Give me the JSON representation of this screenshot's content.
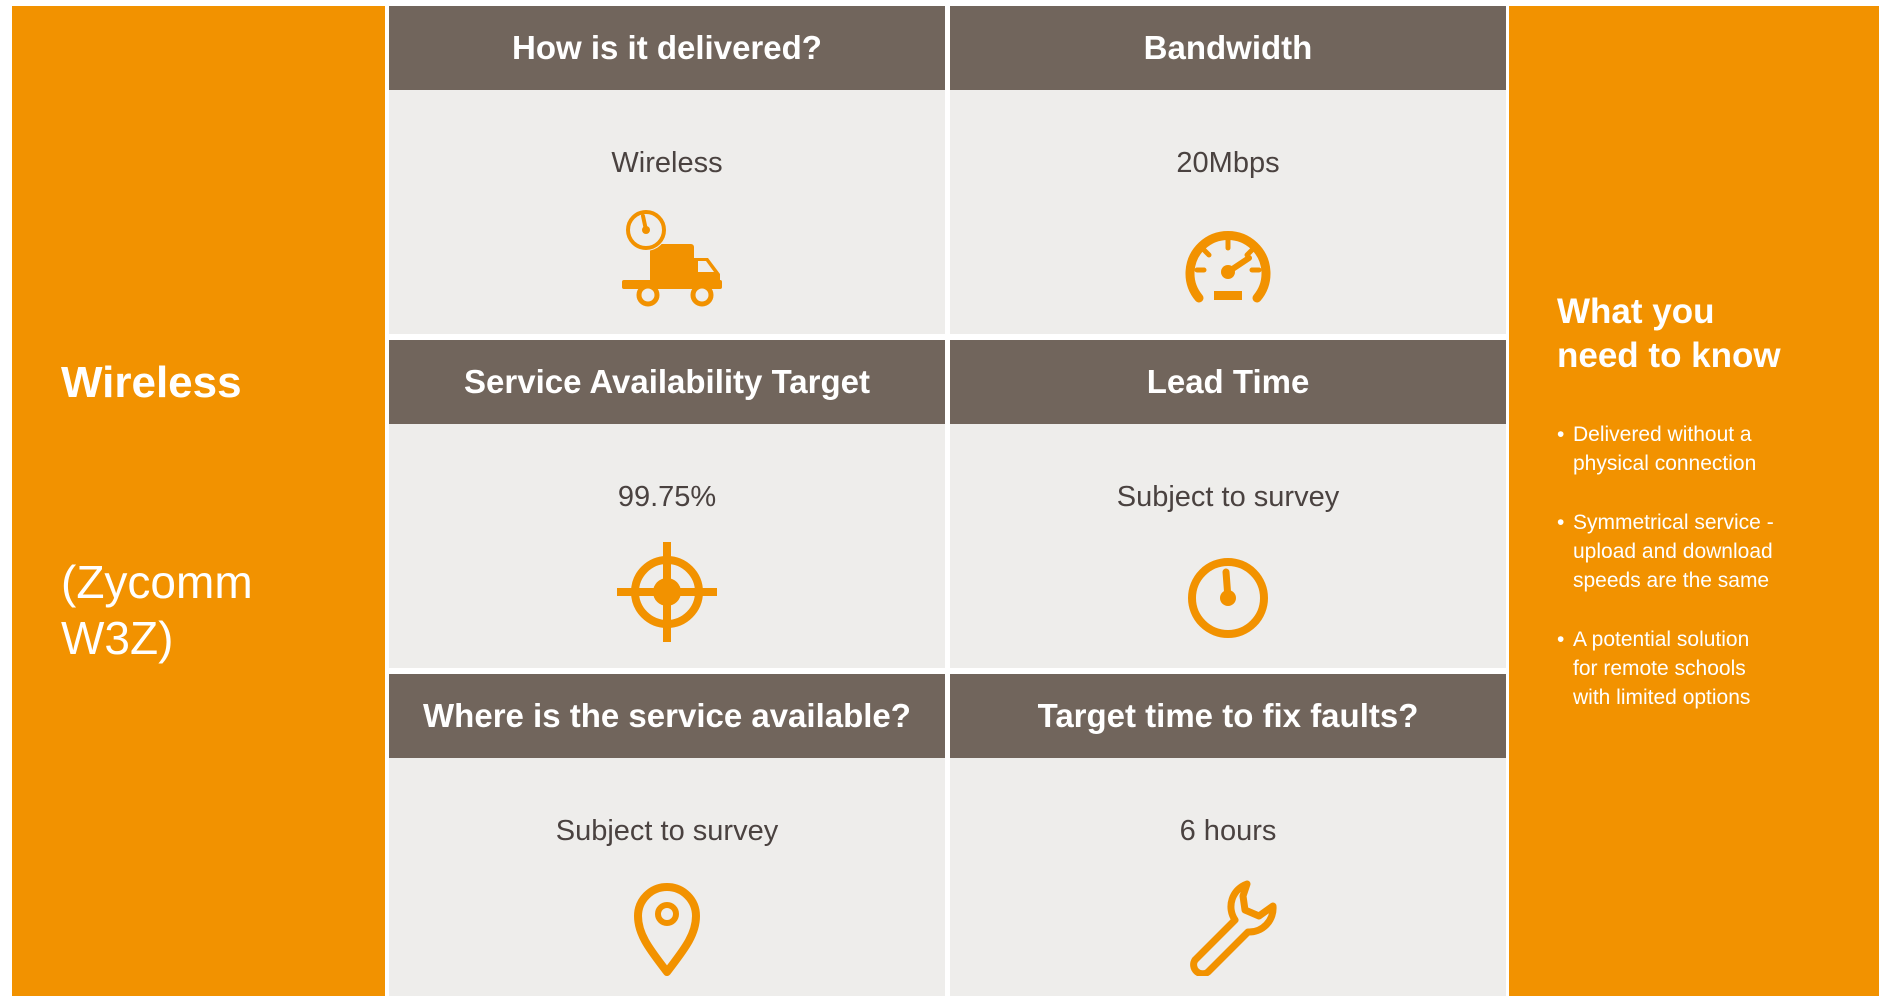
{
  "product": {
    "name": "Wireless",
    "variant_line1": "(Zycomm",
    "variant_line2": "W3Z)"
  },
  "cells": [
    {
      "header": "How is it delivered?",
      "value": "Wireless",
      "icon": "delivery-truck-clock-icon"
    },
    {
      "header": "Bandwidth",
      "value": "20Mbps",
      "icon": "speedometer-icon"
    },
    {
      "header": "Service Availability Target",
      "value": "99.75%",
      "icon": "target-crosshair-icon"
    },
    {
      "header": "Lead Time",
      "value": "Subject to survey",
      "icon": "clock-icon"
    },
    {
      "header": "Where is the service available?",
      "value": "Subject to survey",
      "icon": "location-pin-icon"
    },
    {
      "header": "Target time to fix faults?",
      "value": "6 hours",
      "icon": "wrench-icon"
    }
  ],
  "info": {
    "title_line1": "What you",
    "title_line2": "need to know",
    "bullets": [
      {
        "line1": "Delivered without a",
        "line2": "physical connection"
      },
      {
        "line1": "Symmetrical service -",
        "line2": "upload and download",
        "line3": "speeds are the same"
      },
      {
        "line1": "A potential solution",
        "line2": "for remote schools",
        "line3": "with limited options"
      }
    ]
  },
  "colors": {
    "accent": "#f29200",
    "header_bg": "#71655c",
    "cell_bg": "#eeedeb",
    "text": "#4a4240"
  }
}
